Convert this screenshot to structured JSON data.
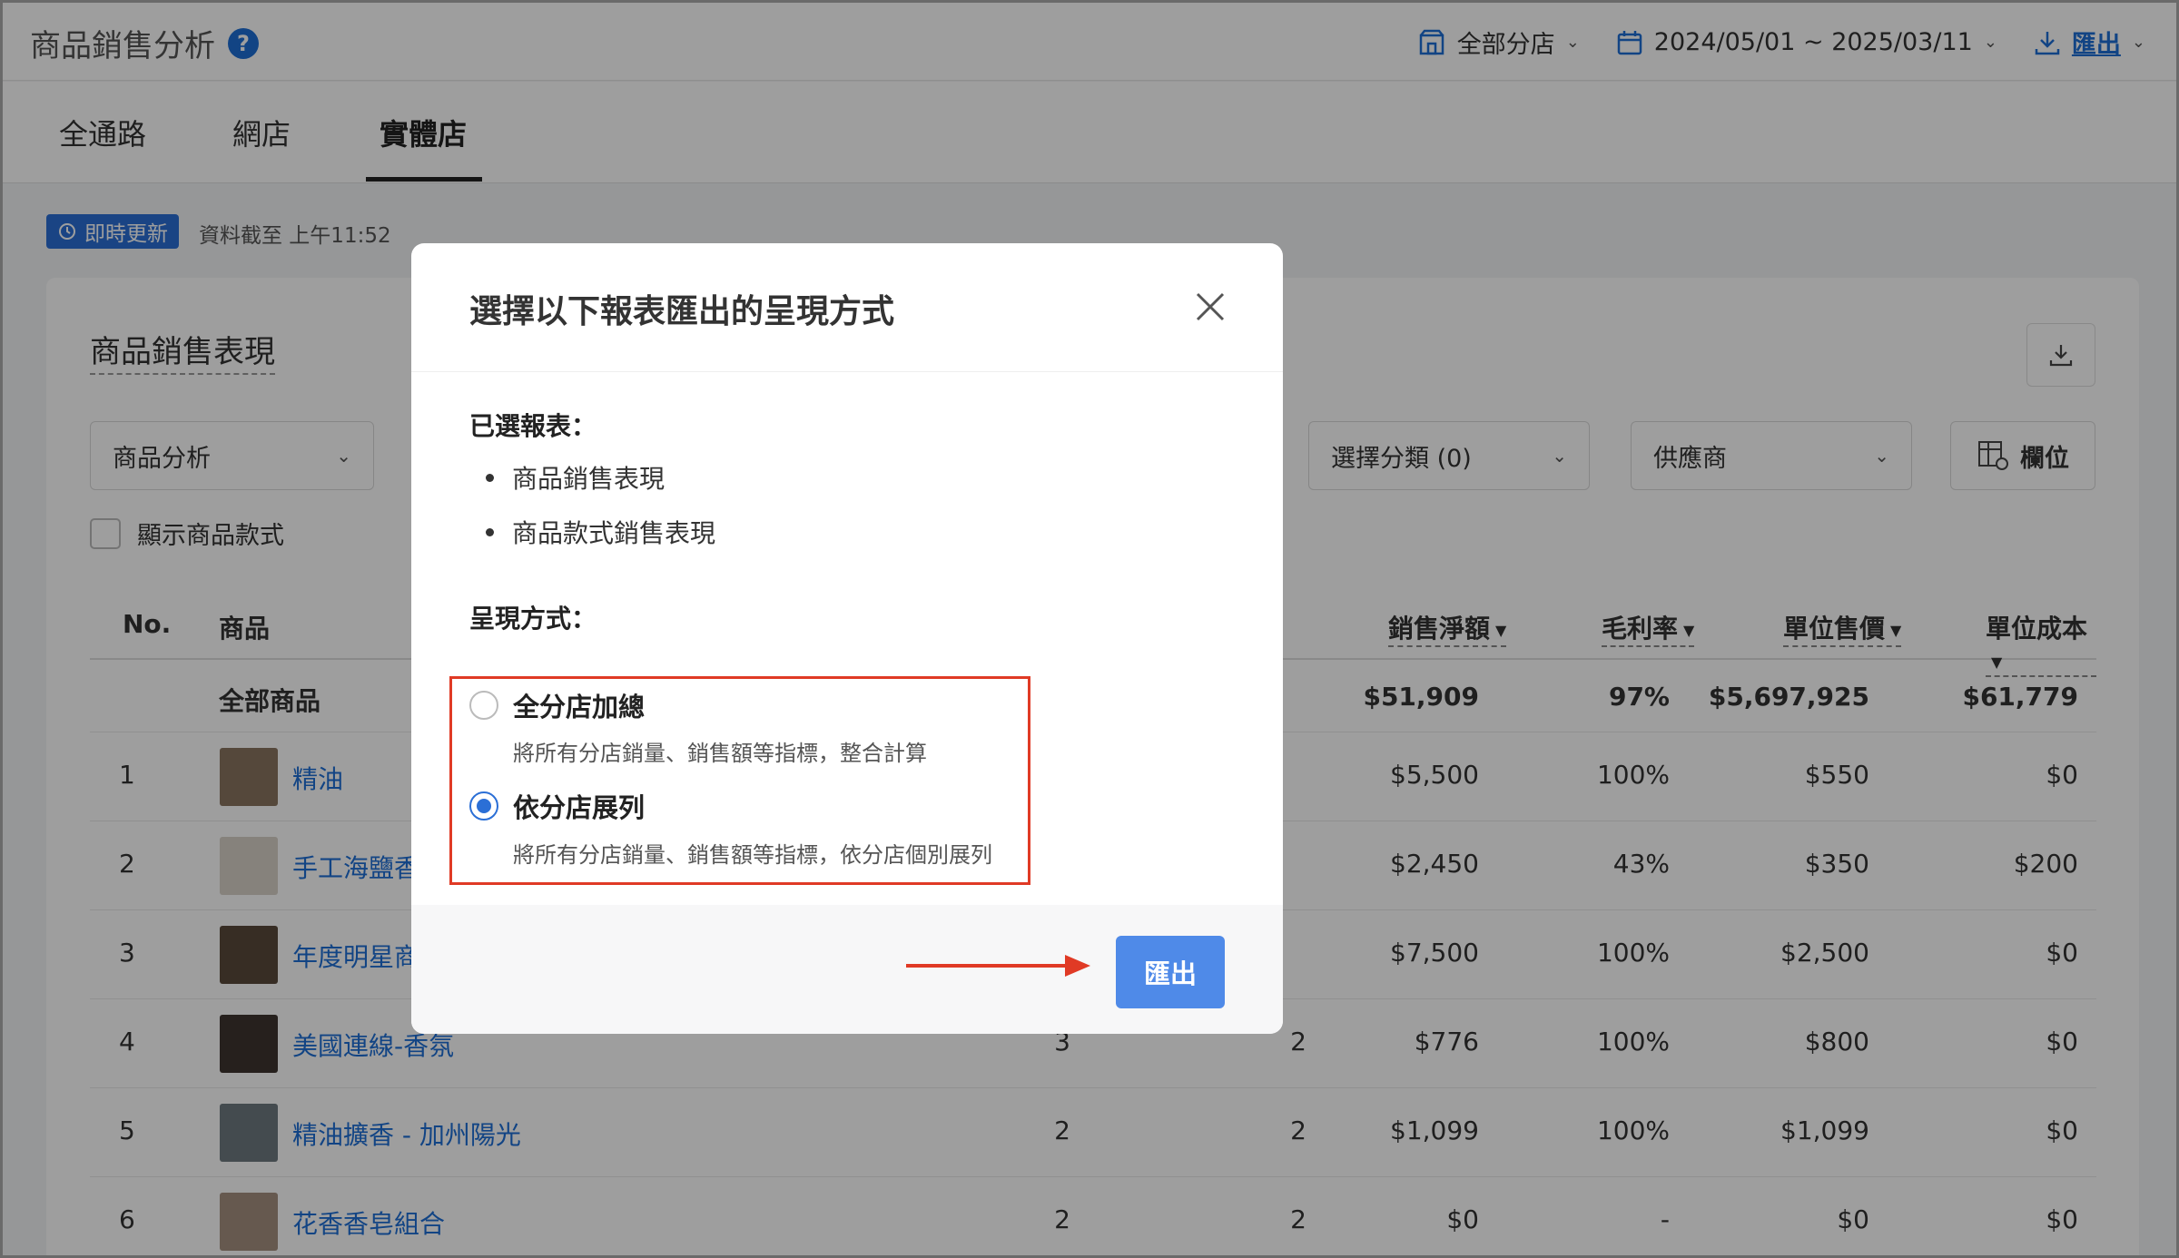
{
  "header": {
    "title": "商品銷售分析",
    "help": "?",
    "store_selector": "全部分店",
    "date_range": "2024/05/01 ~ 2025/03/11",
    "export_label": "匯出"
  },
  "tabs": [
    {
      "label": "全通路"
    },
    {
      "label": "網店"
    },
    {
      "label": "實體店"
    }
  ],
  "realtime": {
    "badge": "即時更新",
    "updated": "資料截至 上午11:52"
  },
  "card": {
    "title": "商品銷售表現",
    "filters": {
      "analysis": "商品分析",
      "category": "選擇分類 (0)",
      "supplier": "供應商",
      "fields": "欄位"
    },
    "show_variants": "顯示商品款式"
  },
  "table": {
    "headers": {
      "no": "No.",
      "product": "商品",
      "net_sales": "銷售淨額",
      "margin": "毛利率",
      "unit_price": "單位售價",
      "unit_cost": "單位成本"
    },
    "total": {
      "label": "全部商品",
      "net_sales": "$51,909",
      "margin": "97%",
      "unit_price": "$5,697,925",
      "unit_cost": "$61,779"
    },
    "rows": [
      {
        "no": "1",
        "name": "精油",
        "qty1": "",
        "qty2": "",
        "net_sales": "$5,500",
        "margin": "100%",
        "unit_price": "$550",
        "unit_cost": "$0",
        "thumb": "#8a7560"
      },
      {
        "no": "2",
        "name": "手工海鹽香",
        "qty1": "",
        "qty2": "",
        "net_sales": "$2,450",
        "margin": "43%",
        "unit_price": "$350",
        "unit_cost": "$200",
        "thumb": "#d8d2c8"
      },
      {
        "no": "3",
        "name": "年度明星商",
        "qty1": "",
        "qty2": "",
        "net_sales": "$7,500",
        "margin": "100%",
        "unit_price": "$2,500",
        "unit_cost": "$0",
        "thumb": "#5a4a3a"
      },
      {
        "no": "4",
        "name": "美國連線-香氛",
        "qty1": "3",
        "qty2": "2",
        "net_sales": "$776",
        "margin": "100%",
        "unit_price": "$800",
        "unit_cost": "$0",
        "thumb": "#3e3530"
      },
      {
        "no": "5",
        "name": "精油擴香 - 加州陽光",
        "qty1": "2",
        "qty2": "2",
        "net_sales": "$1,099",
        "margin": "100%",
        "unit_price": "$1,099",
        "unit_cost": "$0",
        "thumb": "#6e7a80"
      },
      {
        "no": "6",
        "name": "花香香皂組合",
        "qty1": "2",
        "qty2": "2",
        "net_sales": "$0",
        "margin": "-",
        "unit_price": "$0",
        "unit_cost": "$0",
        "thumb": "#a59080"
      }
    ]
  },
  "modal": {
    "title": "選擇以下報表匯出的呈現方式",
    "selected_label": "已選報表：",
    "selected_reports": [
      "商品銷售表現",
      "商品款式銷售表現"
    ],
    "mode_label": "呈現方式：",
    "options": [
      {
        "label": "全分店加總",
        "desc": "將所有分店銷量、銷售額等指標，整合計算",
        "selected": false
      },
      {
        "label": "依分店展列",
        "desc": "將所有分店銷量、銷售額等指標，依分店個別展列",
        "selected": true
      }
    ],
    "export_button": "匯出"
  },
  "colors": {
    "accent": "#2b6fd6",
    "button": "#4f8ae8",
    "highlight": "#e03a25"
  }
}
